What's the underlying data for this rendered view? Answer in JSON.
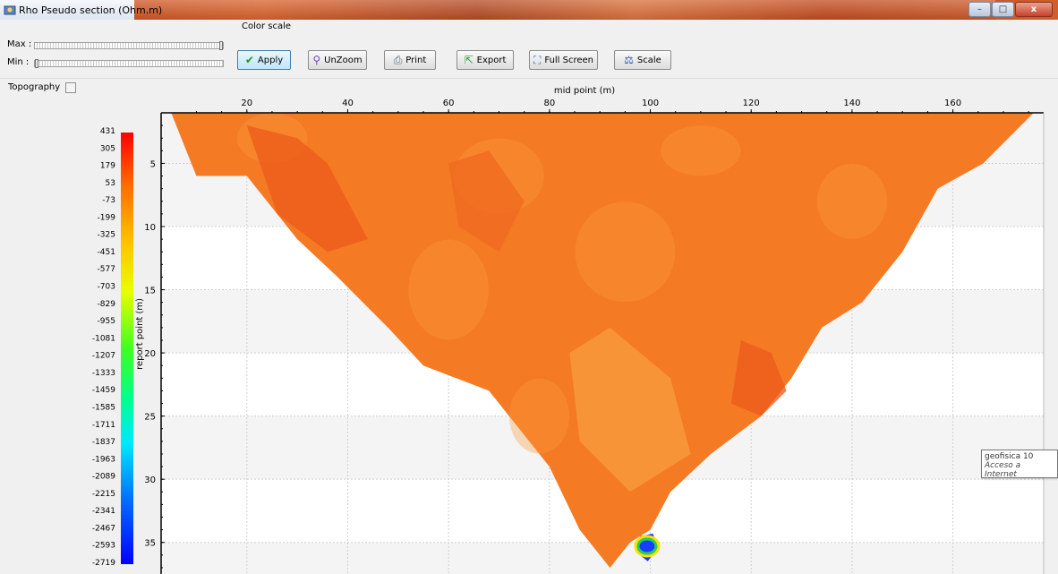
{
  "window": {
    "title": "Rho Pseudo section (Ohm.m)",
    "controls": {
      "minimize": "–",
      "maximize": "□",
      "close": "x"
    }
  },
  "toolbar": {
    "max_label": "Max :",
    "min_label": "Min :",
    "color_scale_label": "Color scale",
    "buttons": {
      "apply": "Apply",
      "unzoom": "UnZoom",
      "print": "Print",
      "export": "Export",
      "fullscreen": "Full Screen",
      "scale": "Scale"
    }
  },
  "side": {
    "topography_label": "Topography",
    "topography_checked": false
  },
  "tooltip": {
    "title": "geofisica 10",
    "subtitle": "Acceso a Internet"
  },
  "colors": {
    "section_fill": "#f47a24",
    "section_dark": "#ee5c1c",
    "section_light": "#f89b3c",
    "anomaly_low": "#1a3cff",
    "anomaly_mid": "#22d05a",
    "anomaly_hi": "#ffe000"
  },
  "chart_data": {
    "type": "heatmap",
    "xlabel": "mid point (m)",
    "ylabel": "report point (m)",
    "x_ticks": [
      20,
      40,
      60,
      80,
      100,
      120,
      140,
      160
    ],
    "y_ticks": [
      5,
      10,
      15,
      20,
      25,
      30,
      35
    ],
    "xlim": [
      3,
      178
    ],
    "ylim": [
      1,
      37.5
    ],
    "colorbar": {
      "labels": [
        "431",
        "305",
        "179",
        "53",
        "-73",
        "-199",
        "-325",
        "-451",
        "-577",
        "-703",
        "-829",
        "-955",
        "-1081",
        "-1207",
        "-1333",
        "-1459",
        "-1585",
        "-1711",
        "-1837",
        "-1963",
        "-2089",
        "-2215",
        "-2341",
        "-2467",
        "-2593",
        "-2719"
      ],
      "max": 431,
      "min": -2719
    },
    "boundary": [
      [
        5,
        1
      ],
      [
        10,
        6
      ],
      [
        20,
        6
      ],
      [
        30,
        11
      ],
      [
        38,
        14
      ],
      [
        48,
        18
      ],
      [
        55,
        21
      ],
      [
        68,
        23
      ],
      [
        80,
        29
      ],
      [
        86,
        34
      ],
      [
        92,
        37
      ],
      [
        96,
        35
      ],
      [
        100,
        34
      ],
      [
        104,
        31
      ],
      [
        112,
        28
      ],
      [
        122,
        25
      ],
      [
        128,
        22
      ],
      [
        134,
        18
      ],
      [
        142,
        16
      ],
      [
        150,
        12
      ],
      [
        157,
        7
      ],
      [
        166,
        5
      ],
      [
        176,
        1
      ]
    ],
    "zones": [
      {
        "level": 431,
        "polygon": [
          [
            20,
            2
          ],
          [
            30,
            3
          ],
          [
            36,
            5
          ],
          [
            40,
            8
          ],
          [
            44,
            11
          ],
          [
            36,
            12
          ],
          [
            26,
            9
          ]
        ]
      },
      {
        "level": 431,
        "polygon": [
          [
            118,
            19
          ],
          [
            124,
            20
          ],
          [
            127,
            23
          ],
          [
            122,
            25
          ],
          [
            116,
            24
          ]
        ]
      },
      {
        "level": 305,
        "polygon": [
          [
            60,
            5
          ],
          [
            68,
            4
          ],
          [
            75,
            8
          ],
          [
            70,
            12
          ],
          [
            62,
            10
          ]
        ]
      },
      {
        "level": 179,
        "polygon": [
          [
            84,
            20
          ],
          [
            92,
            18
          ],
          [
            104,
            22
          ],
          [
            108,
            28
          ],
          [
            96,
            31
          ],
          [
            86,
            27
          ]
        ]
      },
      {
        "level": -2719,
        "polygon": [
          [
            98,
            34.5
          ],
          [
            100.5,
            34.3
          ],
          [
            101.5,
            35.4
          ],
          [
            99.5,
            36.5
          ],
          [
            97.3,
            35.8
          ]
        ]
      }
    ]
  }
}
